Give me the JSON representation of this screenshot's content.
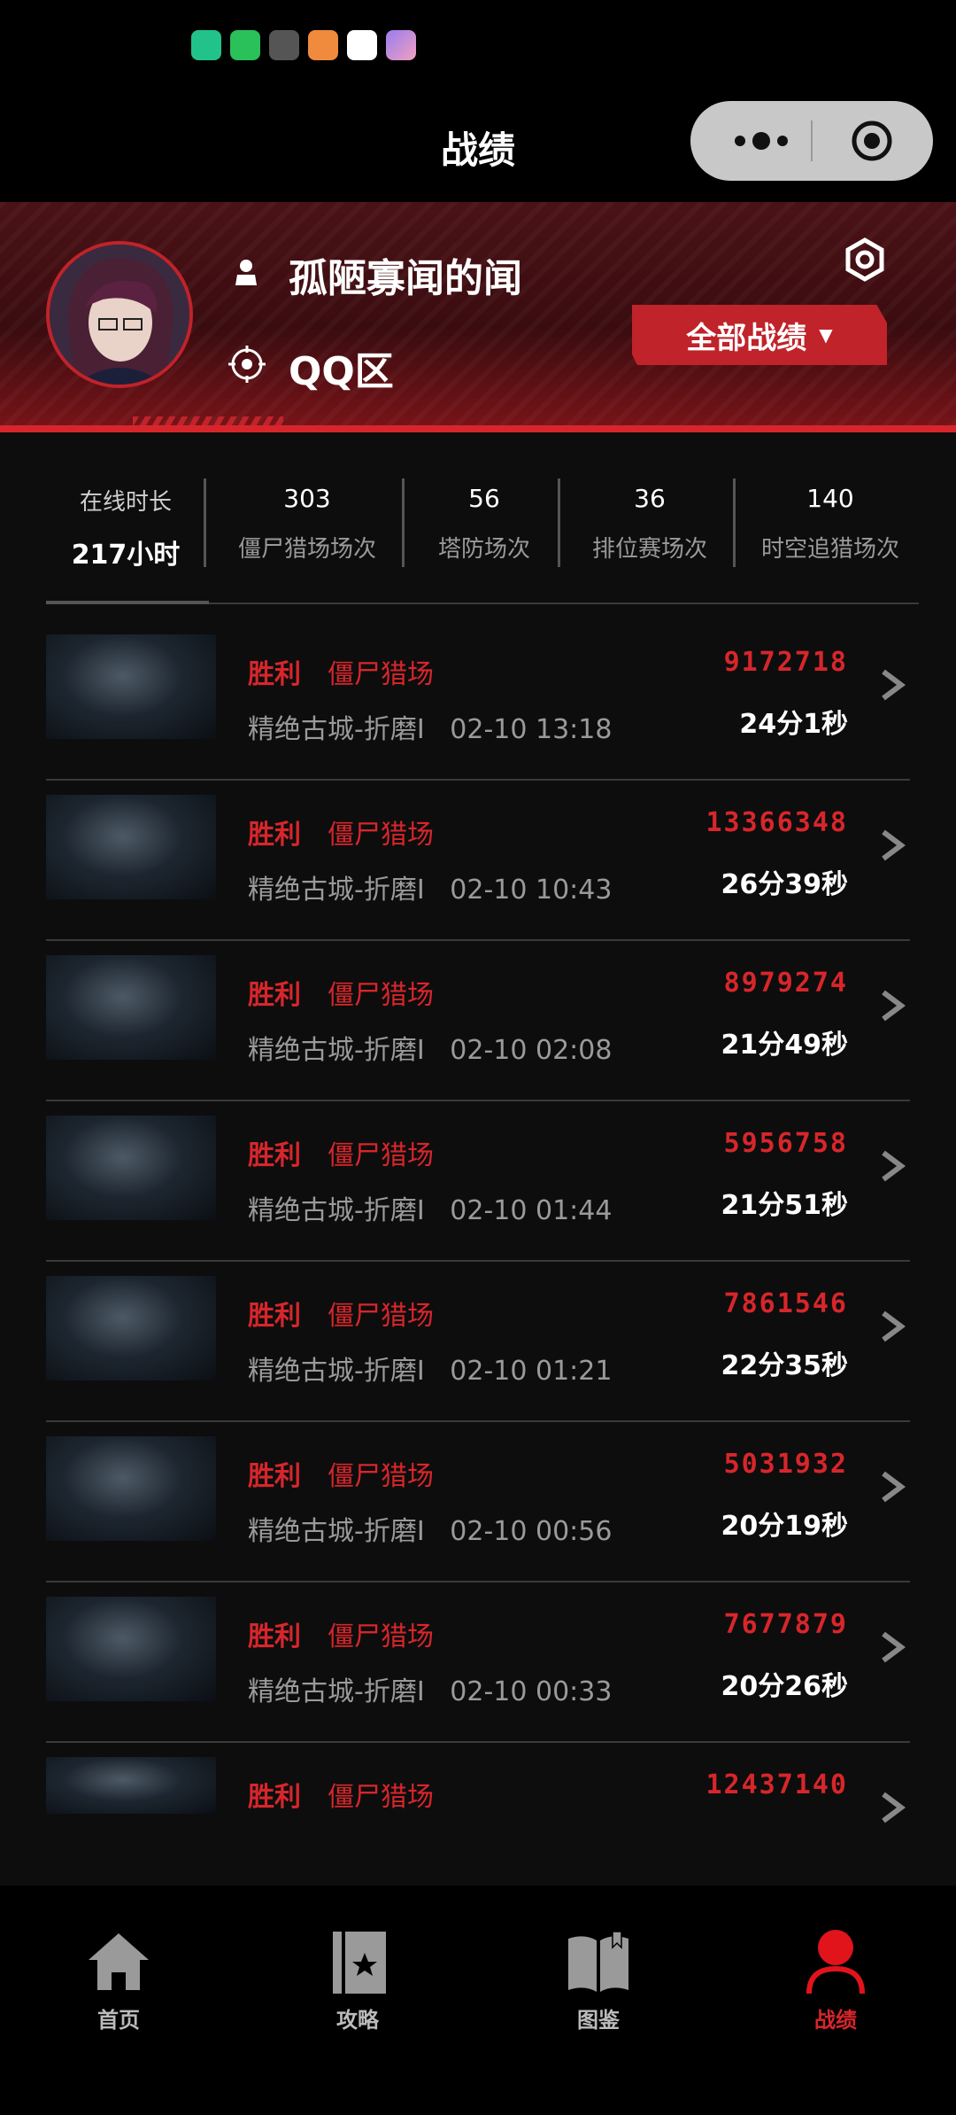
{
  "header": {
    "title": "战绩"
  },
  "profile": {
    "username": "孤陋寡闻的闻",
    "region": "QQ区",
    "filter_label": "全部战绩"
  },
  "stats": [
    {
      "label": "在线时长",
      "value": "217小时"
    },
    {
      "label": "僵尸猎场场次",
      "value": "303"
    },
    {
      "label": "塔防场次",
      "value": "56"
    },
    {
      "label": "排位赛场次",
      "value": "36"
    },
    {
      "label": "时空追猎场次",
      "value": "140"
    }
  ],
  "records": [
    {
      "result": "胜利",
      "mode": "僵尸猎场",
      "map": "精绝古城-折磨I",
      "time": "02-10 13:18",
      "score": "9172718",
      "duration": "24分1秒"
    },
    {
      "result": "胜利",
      "mode": "僵尸猎场",
      "map": "精绝古城-折磨I",
      "time": "02-10 10:43",
      "score": "13366348",
      "duration": "26分39秒"
    },
    {
      "result": "胜利",
      "mode": "僵尸猎场",
      "map": "精绝古城-折磨I",
      "time": "02-10 02:08",
      "score": "8979274",
      "duration": "21分49秒"
    },
    {
      "result": "胜利",
      "mode": "僵尸猎场",
      "map": "精绝古城-折磨I",
      "time": "02-10 01:44",
      "score": "5956758",
      "duration": "21分51秒"
    },
    {
      "result": "胜利",
      "mode": "僵尸猎场",
      "map": "精绝古城-折磨I",
      "time": "02-10 01:21",
      "score": "7861546",
      "duration": "22分35秒"
    },
    {
      "result": "胜利",
      "mode": "僵尸猎场",
      "map": "精绝古城-折磨I",
      "time": "02-10 00:56",
      "score": "5031932",
      "duration": "20分19秒"
    },
    {
      "result": "胜利",
      "mode": "僵尸猎场",
      "map": "精绝古城-折磨I",
      "time": "02-10 00:33",
      "score": "7677879",
      "duration": "20分26秒"
    },
    {
      "result": "胜利",
      "mode": "僵尸猎场",
      "map": "",
      "time": "",
      "score": "12437140",
      "duration": ""
    }
  ],
  "tabs": [
    {
      "label": "首页",
      "icon": "home-icon"
    },
    {
      "label": "攻略",
      "icon": "guide-book-icon"
    },
    {
      "label": "图鉴",
      "icon": "handbook-icon"
    },
    {
      "label": "战绩",
      "icon": "profile-icon",
      "active": true
    }
  ],
  "colors": {
    "accent": "#d7262b",
    "background": "#0d0d0d",
    "muted": "#9a9a9a"
  }
}
